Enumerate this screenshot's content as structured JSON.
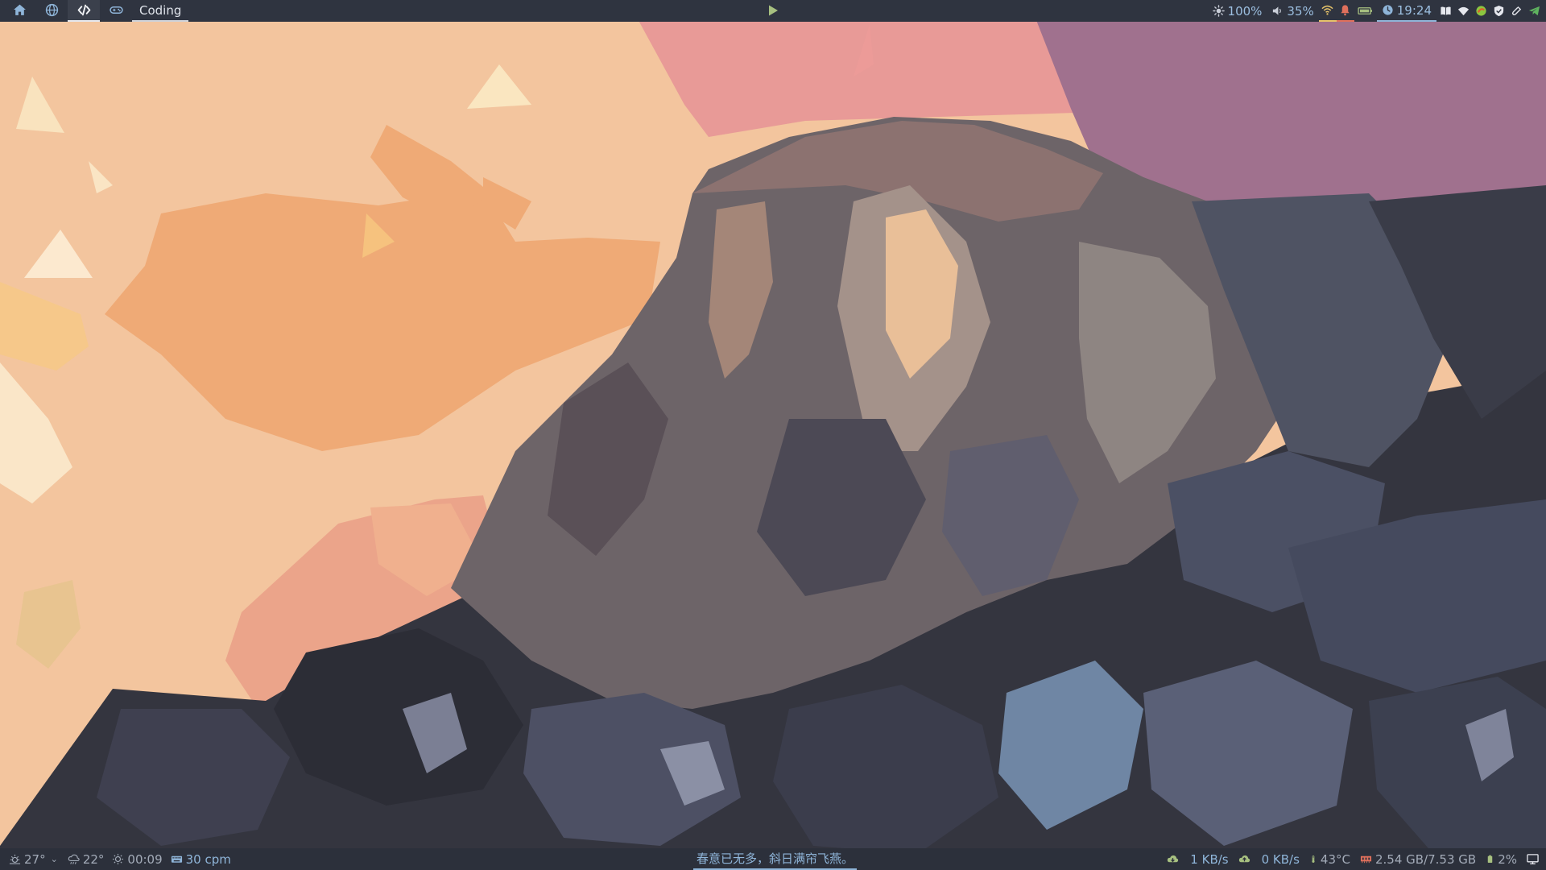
{
  "top_bar": {
    "workspaces": [
      {
        "icon": "home-icon",
        "active": false
      },
      {
        "icon": "globe-icon",
        "active": false
      },
      {
        "icon": "code-icon",
        "active": true
      },
      {
        "icon": "gamepad-icon",
        "active": false
      }
    ],
    "workspace_name": "Coding",
    "media_icon": "play-icon",
    "brightness": "100%",
    "volume": "35%",
    "clock": "19:24",
    "tray_icons": [
      "book-icon",
      "wifi-icon",
      "app-icon",
      "shield-icon",
      "link-icon",
      "telegram-icon"
    ],
    "colors": {
      "accent": "#8fb5d9",
      "notification": "#e0705c",
      "battery": "#a7c080"
    }
  },
  "bottom_bar": {
    "weather_temp": "27°",
    "weather_temp2": "22°",
    "timer": "00:09",
    "typing_speed": "30 cpm",
    "quote": "春意已无多，斜日满帘飞燕。",
    "download": "1 KB/s",
    "upload": "0 KB/s",
    "cpu_temp": "43°C",
    "memory": "2.54 GB/7.53 GB",
    "battery": "2%",
    "icons": [
      "weather-icon",
      "rain-icon",
      "sun-icon",
      "keyboard-icon",
      "cloud-download-icon",
      "cloud-upload-icon",
      "thermometer-icon",
      "memory-icon",
      "battery-icon",
      "monitor-icon"
    ]
  }
}
